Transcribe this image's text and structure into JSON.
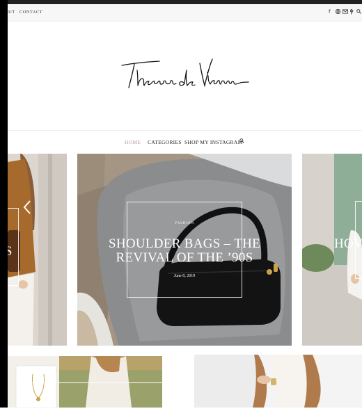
{
  "utility": {
    "links": [
      "OUT",
      "CONTACT"
    ],
    "social_icons": [
      "facebook-icon",
      "instagram-icon",
      "mail-icon",
      "pinterest-icon",
      "search-icon"
    ]
  },
  "header": {
    "logo_text": "Theresa de Vienne"
  },
  "nav": {
    "items": [
      "HOME",
      "CATEGORIES",
      "SHOP MY INSTAGRAM"
    ],
    "search_icon": "search-icon"
  },
  "slider": {
    "left": {
      "title_fragment": "ALS"
    },
    "main": {
      "category": "FASHION",
      "title_line1": "SHOULDER BAGS – THE",
      "title_line2": "REVIVAL OF THE ’90S",
      "date": "June 8, 2019"
    },
    "right": {
      "title_fragment": "HOV"
    },
    "arrow_icon": "chevron-left-icon"
  },
  "colors": {
    "accent": "#c29a9a",
    "text": "#222222"
  }
}
